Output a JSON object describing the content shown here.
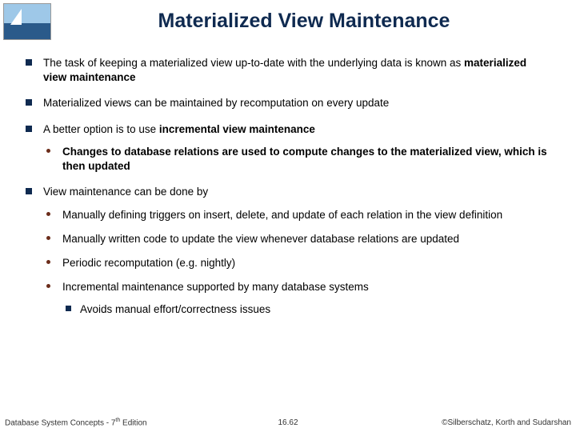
{
  "title": "Materialized View Maintenance",
  "bullets": {
    "b1_pre": "The task of keeping a materialized view up-to-date with the underlying data is known as ",
    "b1_bold": "materialized view maintenance",
    "b2": "Materialized views can be maintained by recomputation on every update",
    "b3_pre": "A better option is to use ",
    "b3_bold": "incremental view maintenance",
    "b3_sub1": "Changes to database relations are used to compute changes to the materialized view, which is then updated",
    "b4": "View maintenance can be done by",
    "b4_sub1": "Manually defining triggers on insert, delete, and update of each relation in the view definition",
    "b4_sub2": "Manually written code to update the view whenever database relations are updated",
    "b4_sub3": "Periodic recomputation (e.g. nightly)",
    "b4_sub4": "Incremental maintenance supported by many database systems",
    "b4_sub4_sub1": "Avoids manual effort/correctness issues"
  },
  "footer": {
    "left_pre": "Database System Concepts - 7",
    "left_sup": "th",
    "left_post": " Edition",
    "center": "16.62",
    "right": "©Silberschatz, Korth and Sudarshan"
  }
}
